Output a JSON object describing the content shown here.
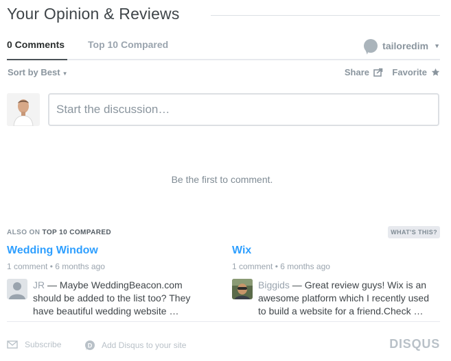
{
  "header": {
    "title": "Your Opinion & Reviews"
  },
  "tabs": {
    "comments": "0 Comments",
    "community": "Top 10 Compared"
  },
  "user": {
    "name": "tailoredim",
    "icon": "user-bubble-icon"
  },
  "toolbar": {
    "sort": "Sort by Best",
    "share": "Share",
    "favorite": "Favorite"
  },
  "composer": {
    "placeholder": "Start the discussion…"
  },
  "empty_message": "Be the first to comment.",
  "also_on": {
    "prefix": "ALSO ON",
    "site": "TOP 10 COMPARED",
    "whats_this": "WHAT'S THIS?"
  },
  "recommendations": [
    {
      "title": "Wedding Window",
      "meta": "1 comment • 6 months ago",
      "author": "JR",
      "excerpt": "Maybe WeddingBeacon.com should be added to the list too? They have beautiful wedding website …"
    },
    {
      "title": "Wix",
      "meta": "1 comment • 6 months ago",
      "author": "Biggids",
      "excerpt": "Great review guys! Wix is an awesome platform which I recently used to build a website for a friend.Check …"
    }
  ],
  "footer": {
    "subscribe": "Subscribe",
    "add_disqus": "Add Disqus to your site",
    "logo": "DISQUS"
  },
  "colors": {
    "link": "#2e9fff",
    "text": "#3f4549",
    "muted": "#8a959e"
  }
}
